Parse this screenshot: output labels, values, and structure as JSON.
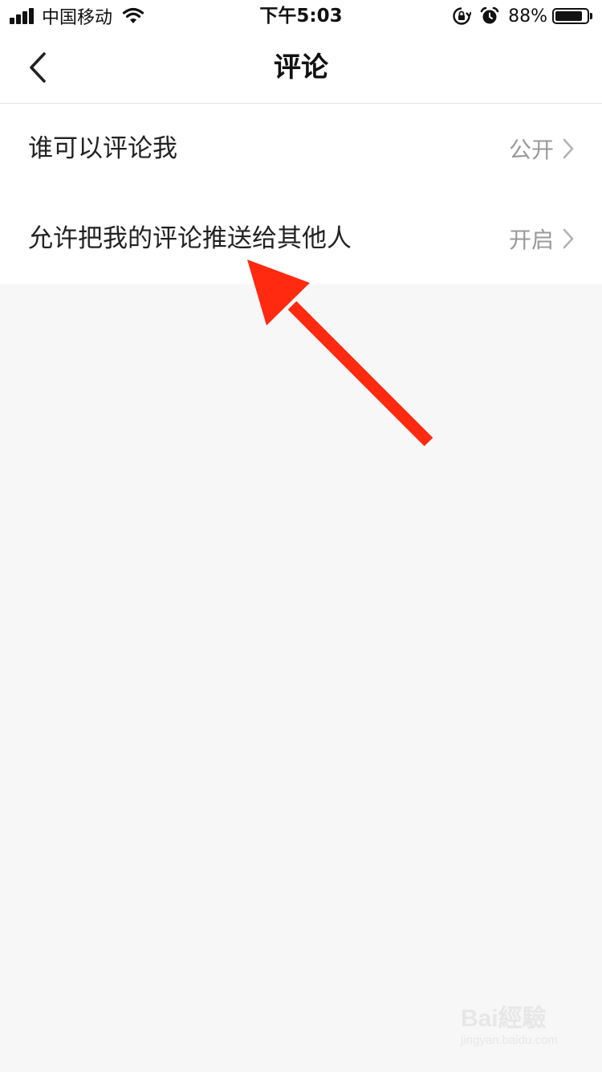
{
  "status_bar": {
    "carrier": "中国移动",
    "time": "下午5:03",
    "battery_percent": "88%",
    "battery_level": 0.88,
    "icons": [
      "signal-icon",
      "wifi-icon",
      "rotation-lock-icon",
      "alarm-icon",
      "battery-icon"
    ]
  },
  "nav": {
    "title": "评论",
    "back_icon": "chevron-left-icon"
  },
  "settings": {
    "items": [
      {
        "label": "谁可以评论我",
        "value": "公开"
      },
      {
        "label": "允许把我的评论推送给其他人",
        "value": "开启"
      }
    ],
    "chevron_icon": "chevron-right-icon"
  },
  "annotation": {
    "icon": "red-arrow-icon",
    "color": "#ff2a10"
  },
  "watermark": {
    "logo_text": "Bai經驗",
    "sub_text": "jingyan.baidu.com"
  },
  "colors": {
    "background": "#f7f7f7",
    "surface": "#ffffff",
    "text_primary": "#222222",
    "text_secondary": "#9a9a9a",
    "divider": "#e2e2e2"
  }
}
